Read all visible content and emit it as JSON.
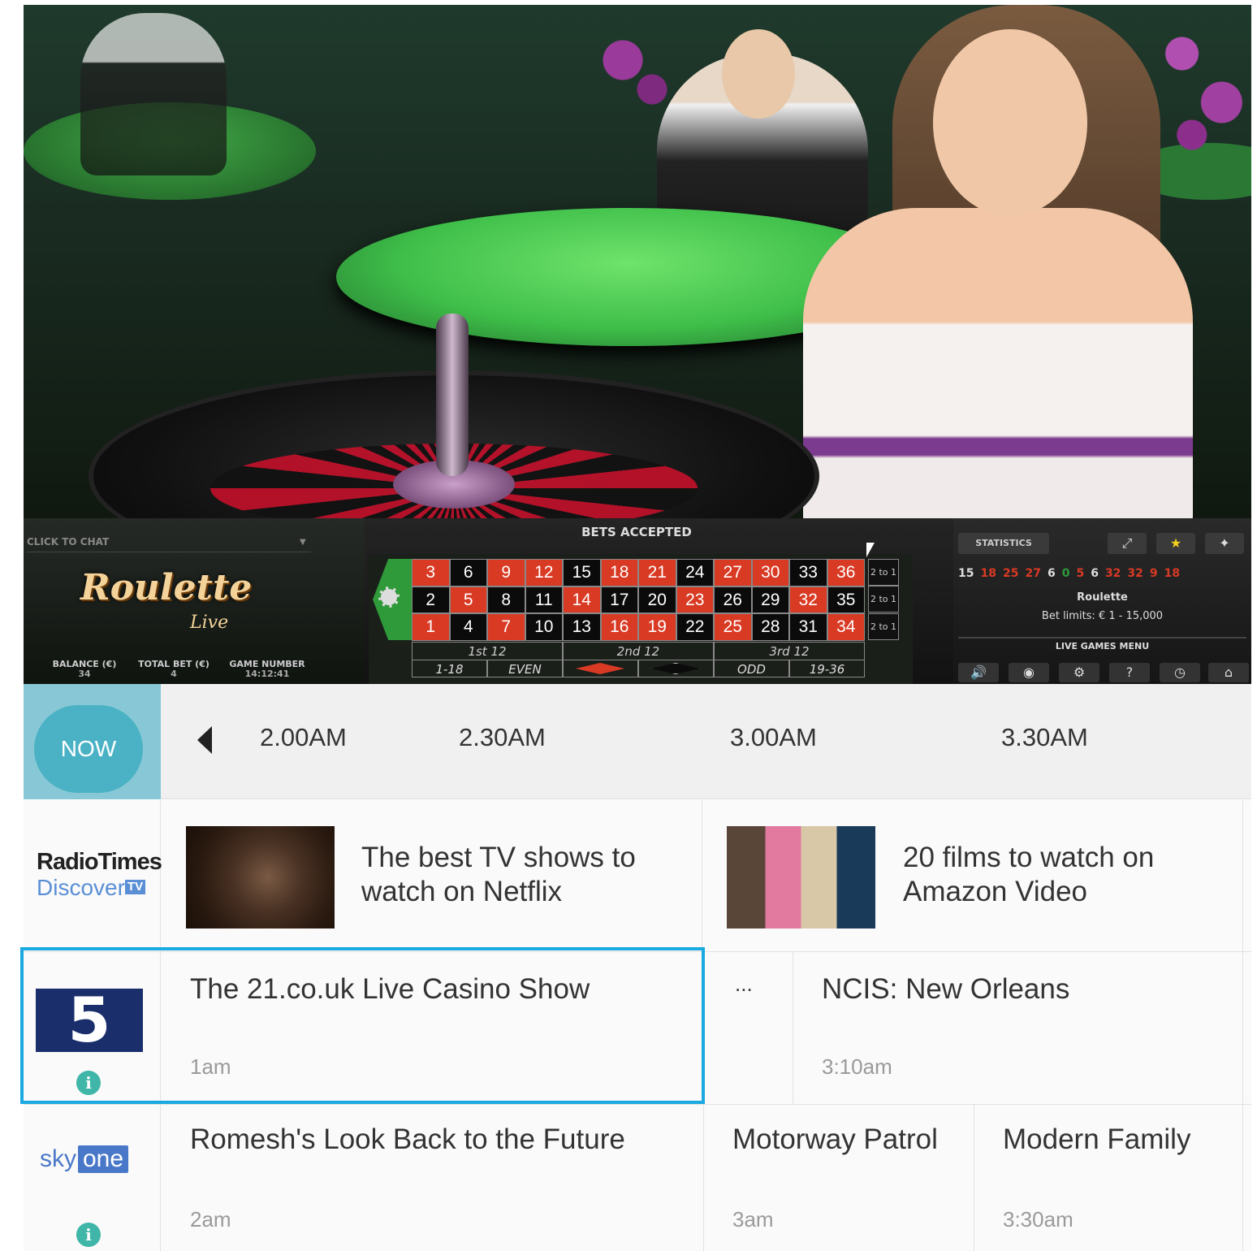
{
  "video": {
    "chat_placeholder": "CLICK TO CHAT",
    "logo_main": "Roulette",
    "logo_sub": "Live",
    "status": "BETS ACCEPTED",
    "stats": [
      {
        "label": "BALANCE (€)",
        "value": "34"
      },
      {
        "label": "TOTAL BET (€)",
        "value": "4"
      },
      {
        "label": "GAME NUMBER",
        "value": "14:12:41"
      }
    ],
    "board": {
      "zero": "0",
      "rows": [
        [
          {
            "n": "3",
            "c": "red"
          },
          {
            "n": "6",
            "c": "black"
          },
          {
            "n": "9",
            "c": "red"
          },
          {
            "n": "12",
            "c": "red"
          },
          {
            "n": "15",
            "c": "black"
          },
          {
            "n": "18",
            "c": "red"
          },
          {
            "n": "21",
            "c": "red"
          },
          {
            "n": "24",
            "c": "black"
          },
          {
            "n": "27",
            "c": "red"
          },
          {
            "n": "30",
            "c": "red"
          },
          {
            "n": "33",
            "c": "black"
          },
          {
            "n": "36",
            "c": "red"
          }
        ],
        [
          {
            "n": "2",
            "c": "black"
          },
          {
            "n": "5",
            "c": "red"
          },
          {
            "n": "8",
            "c": "black"
          },
          {
            "n": "11",
            "c": "black"
          },
          {
            "n": "14",
            "c": "red"
          },
          {
            "n": "17",
            "c": "black"
          },
          {
            "n": "20",
            "c": "black"
          },
          {
            "n": "23",
            "c": "red"
          },
          {
            "n": "26",
            "c": "black"
          },
          {
            "n": "29",
            "c": "black"
          },
          {
            "n": "32",
            "c": "red"
          },
          {
            "n": "35",
            "c": "black"
          }
        ],
        [
          {
            "n": "1",
            "c": "red"
          },
          {
            "n": "4",
            "c": "black"
          },
          {
            "n": "7",
            "c": "red"
          },
          {
            "n": "10",
            "c": "black"
          },
          {
            "n": "13",
            "c": "black"
          },
          {
            "n": "16",
            "c": "red"
          },
          {
            "n": "19",
            "c": "red"
          },
          {
            "n": "22",
            "c": "black"
          },
          {
            "n": "25",
            "c": "red"
          },
          {
            "n": "28",
            "c": "black"
          },
          {
            "n": "31",
            "c": "black"
          },
          {
            "n": "34",
            "c": "red"
          }
        ]
      ],
      "column_bet": "2 to 1",
      "dozens": [
        "1st 12",
        "2nd 12",
        "3rd 12"
      ],
      "outside": [
        "1-18",
        "EVEN",
        "ODD",
        "19-36"
      ]
    },
    "statistics_label": "STATISTICS",
    "history": [
      {
        "n": "15",
        "c": "black"
      },
      {
        "n": "18",
        "c": "red"
      },
      {
        "n": "25",
        "c": "red"
      },
      {
        "n": "27",
        "c": "red"
      },
      {
        "n": "6",
        "c": "black"
      },
      {
        "n": "0",
        "c": "green"
      },
      {
        "n": "5",
        "c": "red"
      },
      {
        "n": "6",
        "c": "black"
      },
      {
        "n": "32",
        "c": "red"
      },
      {
        "n": "32",
        "c": "red"
      },
      {
        "n": "9",
        "c": "red"
      },
      {
        "n": "18",
        "c": "red"
      }
    ],
    "game_title": "Roulette",
    "bet_limits": "Bet limits: € 1 - 15,000",
    "menu_label": "LIVE GAMES MENU"
  },
  "guide": {
    "now_label": "NOW",
    "times": [
      "2.00AM",
      "2.30AM",
      "3.00AM",
      "3.30AM"
    ],
    "rows": [
      {
        "channel": {
          "name_line1": "RadioTimes",
          "name_line2": "Discover",
          "badge": "TV"
        },
        "items": [
          {
            "title": "The best TV shows to watch on Netflix"
          },
          {
            "title": "20 films to watch on Amazon Video"
          }
        ]
      },
      {
        "channel": {
          "name": "5"
        },
        "items": [
          {
            "title": "The 21.co.uk Live Casino Show",
            "time": "1am"
          },
          {
            "title": "...",
            "time": ""
          },
          {
            "title": "NCIS: New Orleans",
            "time": "3:10am"
          }
        ]
      },
      {
        "channel": {
          "name_a": "sky",
          "name_b": "one"
        },
        "items": [
          {
            "title": "Romesh's Look Back to the Future",
            "time": "2am"
          },
          {
            "title": "Motorway Patrol",
            "time": "3am"
          },
          {
            "title": "Modern Family",
            "time": "3:30am"
          }
        ]
      }
    ],
    "colors": {
      "accent": "#4ab2c4",
      "highlight": "#1aa9e0",
      "info": "#3fb6a8"
    }
  }
}
